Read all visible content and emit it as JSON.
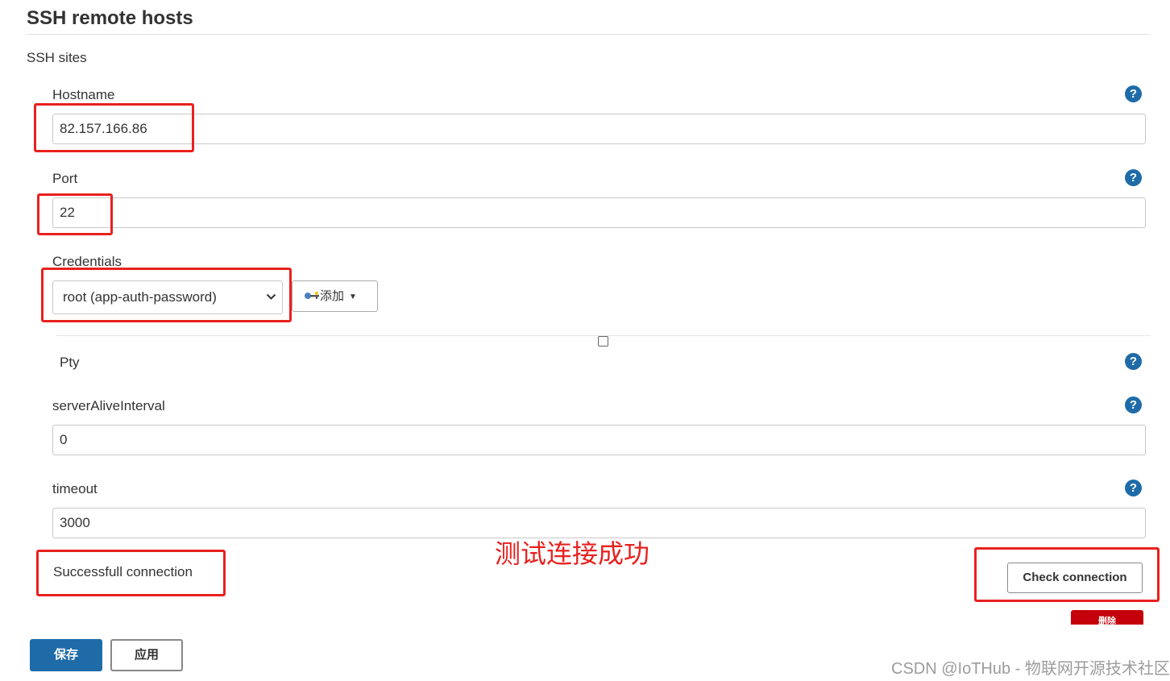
{
  "section": {
    "title": "SSH remote hosts",
    "subsection": "SSH sites"
  },
  "fields": {
    "hostname": {
      "label": "Hostname",
      "value": "82.157.166.86"
    },
    "port": {
      "label": "Port",
      "value": "22"
    },
    "credentials": {
      "label": "Credentials",
      "selected": "root (app-auth-password)",
      "add_label": "添加"
    },
    "pty": {
      "label": "Pty",
      "checked": false
    },
    "server_alive_interval": {
      "label": "serverAliveInterval",
      "value": "0"
    },
    "timeout": {
      "label": "timeout",
      "value": "3000"
    }
  },
  "help_icon_glyph": "?",
  "status": {
    "message": "Successfull connection"
  },
  "annotation": {
    "text": "测试连接成功",
    "color": "#e8211e"
  },
  "buttons": {
    "check_connection": "Check connection",
    "delete": "删除",
    "save": "保存",
    "apply": "应用"
  },
  "watermark": "CSDN @IoTHub - 物联网开源技术社区",
  "colors": {
    "primary": "#1e6ba8",
    "danger": "#c4000a",
    "annotation": "#e8211e"
  },
  "icons": {
    "help": "question-circle-icon",
    "key": "key-icon",
    "dropdown": "chevron-down-icon"
  }
}
